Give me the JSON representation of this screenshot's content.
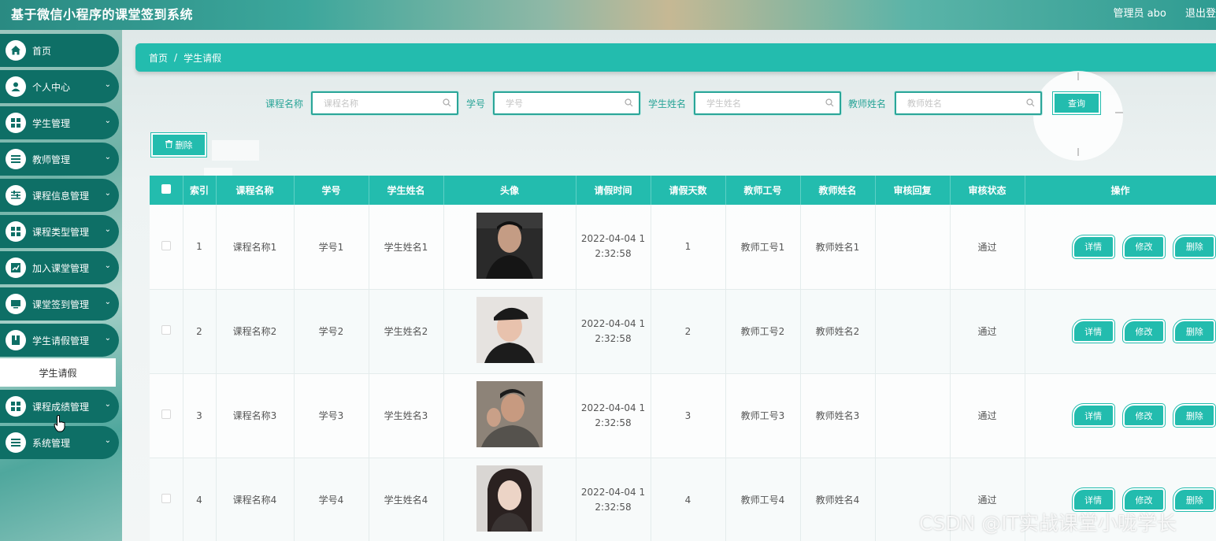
{
  "app": {
    "title": "基于微信小程序的课堂签到系统",
    "user_label": "管理员 abo",
    "logout_label": "退出登"
  },
  "sidebar": {
    "items": [
      {
        "label": "首页",
        "icon": "home-icon",
        "has_chevron": false
      },
      {
        "label": "个人中心",
        "icon": "user-icon",
        "has_chevron": true
      },
      {
        "label": "学生管理",
        "icon": "grid-icon",
        "has_chevron": true
      },
      {
        "label": "教师管理",
        "icon": "list-icon",
        "has_chevron": true
      },
      {
        "label": "课程信息管理",
        "icon": "sliders-icon",
        "has_chevron": true
      },
      {
        "label": "课程类型管理",
        "icon": "grid-icon",
        "has_chevron": true
      },
      {
        "label": "加入课堂管理",
        "icon": "chart-icon",
        "has_chevron": true
      },
      {
        "label": "课堂签到管理",
        "icon": "monitor-icon",
        "has_chevron": true
      },
      {
        "label": "学生请假管理",
        "icon": "book-icon",
        "has_chevron": true
      },
      {
        "label": "课程成绩管理",
        "icon": "grid-icon",
        "has_chevron": true
      },
      {
        "label": "系统管理",
        "icon": "list-icon",
        "has_chevron": true
      }
    ],
    "active_sub": "学生请假"
  },
  "breadcrumb": {
    "home": "首页",
    "separator": "/",
    "current": "学生请假"
  },
  "filters": [
    {
      "label": "课程名称",
      "placeholder": "课程名称",
      "value": ""
    },
    {
      "label": "学号",
      "placeholder": "学号",
      "value": ""
    },
    {
      "label": "学生姓名",
      "placeholder": "学生姓名",
      "value": ""
    },
    {
      "label": "教师姓名",
      "placeholder": "教师姓名",
      "value": ""
    }
  ],
  "actions": {
    "query_label": "查询",
    "delete_label": "删除"
  },
  "table": {
    "columns": [
      "索引",
      "课程名称",
      "学号",
      "学生姓名",
      "头像",
      "请假时间",
      "请假天数",
      "教师工号",
      "教师姓名",
      "审核回复",
      "审核状态",
      "操作"
    ],
    "rows": [
      {
        "index": "1",
        "course": "课程名称1",
        "student_no": "学号1",
        "student_name": "学生姓名1",
        "time_line1": "2022-04-04 1",
        "time_line2": "2:32:58",
        "days": "1",
        "teacher_no": "教师工号1",
        "teacher_name": "教师姓名1",
        "reply": "",
        "status": "通过"
      },
      {
        "index": "2",
        "course": "课程名称2",
        "student_no": "学号2",
        "student_name": "学生姓名2",
        "time_line1": "2022-04-04 1",
        "time_line2": "2:32:58",
        "days": "2",
        "teacher_no": "教师工号2",
        "teacher_name": "教师姓名2",
        "reply": "",
        "status": "通过"
      },
      {
        "index": "3",
        "course": "课程名称3",
        "student_no": "学号3",
        "student_name": "学生姓名3",
        "time_line1": "2022-04-04 1",
        "time_line2": "2:32:58",
        "days": "3",
        "teacher_no": "教师工号3",
        "teacher_name": "教师姓名3",
        "reply": "",
        "status": "通过"
      },
      {
        "index": "4",
        "course": "课程名称4",
        "student_no": "学号4",
        "student_name": "学生姓名4",
        "time_line1": "2022-04-04 1",
        "time_line2": "2:32:58",
        "days": "4",
        "teacher_no": "教师工号4",
        "teacher_name": "教师姓名4",
        "reply": "",
        "status": "通过"
      }
    ],
    "row_actions": {
      "detail": "详情",
      "edit": "修改",
      "delete": "删除"
    }
  },
  "watermark": "CSDN @IT实战课堂小咙学长",
  "colors": {
    "accent": "#23bcae",
    "sidebar_item": "#0e6f66",
    "label": "#2aa598"
  }
}
